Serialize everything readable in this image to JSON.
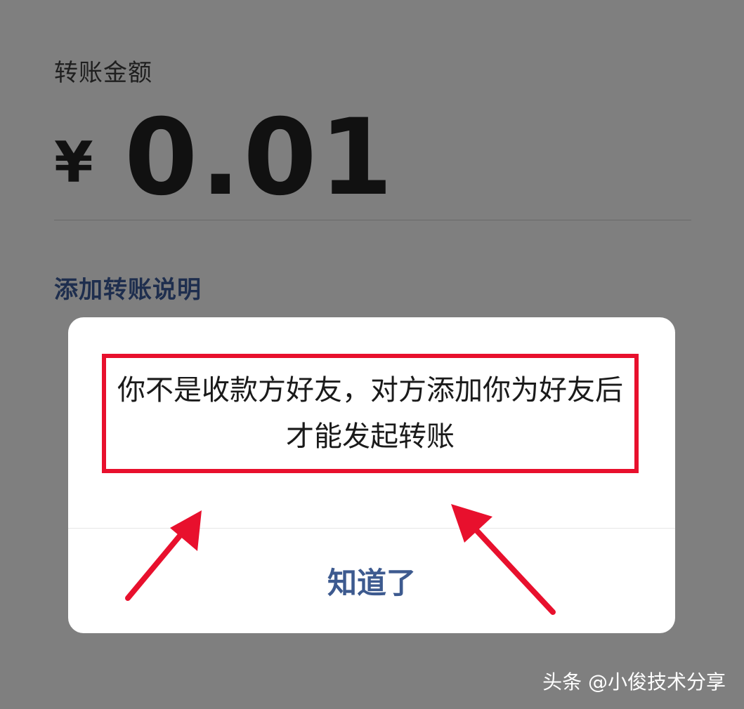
{
  "transfer": {
    "amount_label": "转账金额",
    "currency_symbol": "¥",
    "amount_value": "0.01",
    "add_note_label": "添加转账说明"
  },
  "dialog": {
    "message": "你不是收款方好友，对方添加你为好友后才能发起转账",
    "confirm_label": "知道了"
  },
  "watermark": {
    "text": "头条 @小俊技术分享"
  },
  "colors": {
    "overlay": "#7f7f7f",
    "highlight_box": "#e8102d",
    "annotation_arrow": "#e8102d",
    "confirm_text": "#3d5a8f",
    "note_link": "#1e2e4e"
  },
  "icons": {
    "annotation": "red-arrow-icon"
  }
}
